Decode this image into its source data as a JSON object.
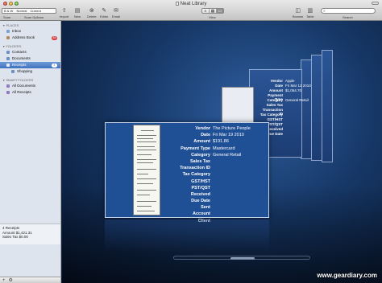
{
  "window": {
    "title": "Neat Library"
  },
  "toolbar": {
    "scan_combo": [
      "B & W",
      "Normal",
      "Current"
    ],
    "scan_label": "Scan Options",
    "tools": [
      {
        "glyph": "⎙",
        "label": "Scan",
        "icon": "scan-icon"
      },
      {
        "glyph": "⇪",
        "label": "Import",
        "icon": "import-icon"
      },
      {
        "glyph": "▤",
        "label": "New",
        "icon": "new-icon"
      },
      {
        "glyph": "⊗",
        "label": "Delete",
        "icon": "delete-icon"
      },
      {
        "glyph": "✎",
        "label": "Editor",
        "icon": "editor-icon"
      },
      {
        "glyph": "✉",
        "label": "Email",
        "icon": "email-icon"
      }
    ],
    "view_label": "View",
    "browse_label": "Browse",
    "table_label": "Table",
    "search_label": "Search"
  },
  "sidebar": {
    "places_label": "Places",
    "places": [
      {
        "label": "Inbox",
        "badge": ""
      },
      {
        "label": "Address Book",
        "badge": "45"
      }
    ],
    "folders_label": "Folders",
    "folders": [
      {
        "label": "Contacts",
        "badge": ""
      },
      {
        "label": "Documents",
        "badge": ""
      },
      {
        "label": "Receipts",
        "badge": "4"
      },
      {
        "label": "Shopping",
        "badge": ""
      }
    ],
    "smart_label": "Smart Folders",
    "smart": [
      {
        "label": "All Documents",
        "badge": ""
      },
      {
        "label": "All Receipts",
        "badge": ""
      }
    ],
    "summary": [
      "4 Receipts",
      "Amount $1,421.31",
      "Sales Tax $0.00"
    ]
  },
  "receipt_main": {
    "fields": [
      {
        "k": "Vendor",
        "v": "The Picture People"
      },
      {
        "k": "Date",
        "v": "Fri Mar 19 2010"
      },
      {
        "k": "Amount",
        "v": "$191.86"
      },
      {
        "k": "Payment Type",
        "v": "Mastercard"
      },
      {
        "k": "Category",
        "v": "General Retail"
      },
      {
        "k": "Sales Tax",
        "v": ""
      },
      {
        "k": "Transaction ID",
        "v": ""
      },
      {
        "k": "Tax Category",
        "v": ""
      },
      {
        "k": "GST/HST",
        "v": ""
      },
      {
        "k": "PST/QST",
        "v": ""
      },
      {
        "k": "Received",
        "v": ""
      },
      {
        "k": "Due Date",
        "v": ""
      },
      {
        "k": "Sent",
        "v": ""
      },
      {
        "k": "Account",
        "v": ""
      },
      {
        "k": "Client",
        "v": ""
      }
    ]
  },
  "receipt_back": {
    "fields": [
      {
        "k": "Vendor",
        "v": "Apple"
      },
      {
        "k": "Date",
        "v": "Fri Mar 12 2010"
      },
      {
        "k": "Amount",
        "v": "$1,054.70"
      },
      {
        "k": "Payment Type",
        "v": ""
      },
      {
        "k": "Category",
        "v": "General Retail"
      },
      {
        "k": "Sales Tax",
        "v": ""
      },
      {
        "k": "Transaction ID",
        "v": ""
      },
      {
        "k": "Tax Category",
        "v": ""
      },
      {
        "k": "GST/HST",
        "v": ""
      },
      {
        "k": "PST/QST",
        "v": ""
      },
      {
        "k": "Received",
        "v": ""
      },
      {
        "k": "Due Date",
        "v": ""
      }
    ]
  },
  "watermark": "www.geardiary.com",
  "colors": {
    "flow_bg": "#163766",
    "card": "#1f4f95",
    "sidebar": "#dde4ed",
    "selection": "#3e72bf"
  }
}
